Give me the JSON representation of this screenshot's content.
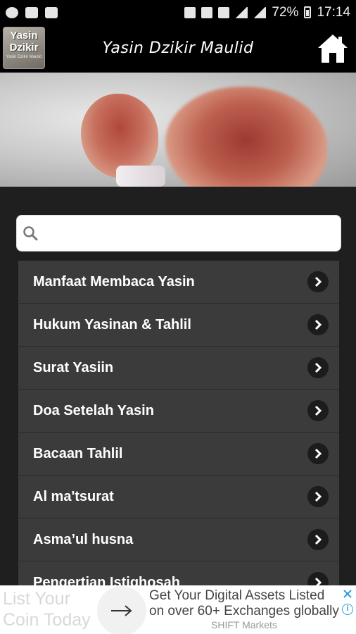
{
  "status_bar": {
    "battery": "72%",
    "time": "17:14"
  },
  "app_bar": {
    "title": "Yasin Dzikir Maulid",
    "logo_line1": "Yasin",
    "logo_line2": "Dzikir",
    "logo_line3": "Yasin Dzikir Maulid"
  },
  "search": {
    "placeholder": ""
  },
  "menu": [
    {
      "label": "Manfaat Membaca Yasin"
    },
    {
      "label": "Hukum Yasinan & Tahlil"
    },
    {
      "label": "Surat Yasiin"
    },
    {
      "label": "Doa Setelah Yasin"
    },
    {
      "label": "Bacaan Tahlil"
    },
    {
      "label": "Al ma'tsurat"
    },
    {
      "label": "Asma’ul husna"
    },
    {
      "label": "Pengertian Istighosah"
    }
  ],
  "ad": {
    "left_line1": "List Your",
    "left_line2": "Coin Today",
    "text": "Get Your Digital Assets Listed on over 60+ Exchanges globally",
    "sponsor": "SHIFT Markets",
    "info_glyph": "i"
  },
  "colors": {
    "background": "#1f1f1f",
    "list_item": "#3b3b3b",
    "bar": "#000000",
    "info_blue": "#2a9fd8"
  }
}
